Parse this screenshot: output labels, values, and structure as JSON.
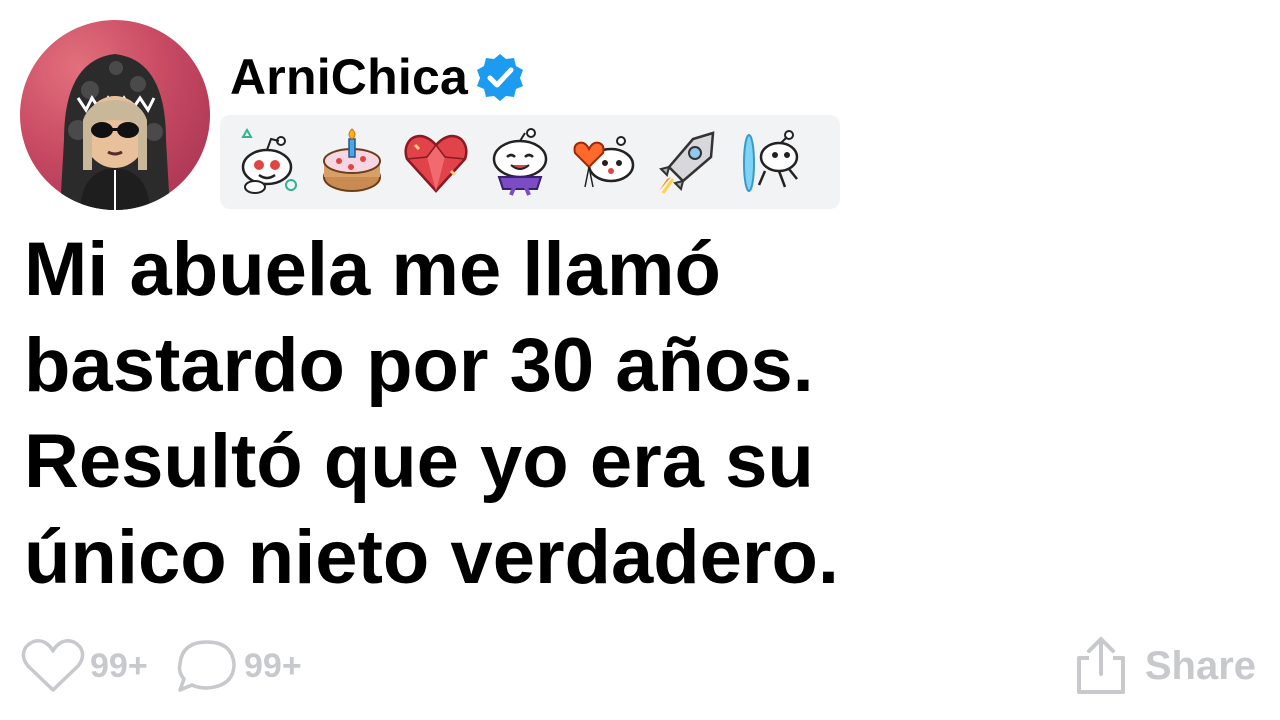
{
  "post": {
    "username": "ArniChica",
    "verified_icon": "verified-badge-icon",
    "title_lines": [
      "Mi abuela me llamó",
      "bastardo por 30 años.",
      "Resultó que yo era su",
      "único nieto verdadero."
    ]
  },
  "awards": [
    {
      "icon": "wholesome-snoo-icon"
    },
    {
      "icon": "birthday-cake-icon"
    },
    {
      "icon": "crystal-heart-icon"
    },
    {
      "icon": "silly-snoo-icon"
    },
    {
      "icon": "heart-snoo-icon"
    },
    {
      "icon": "rocket-icon"
    },
    {
      "icon": "portal-snoo-icon"
    }
  ],
  "footer": {
    "likes": "99+",
    "comments": "99+",
    "share_label": "Share"
  },
  "colors": {
    "verified": "#1d9bf0",
    "muted": "#c7c9cd",
    "awards_bg": "#f2f3f5",
    "avatar_bg": "#c84a63"
  }
}
